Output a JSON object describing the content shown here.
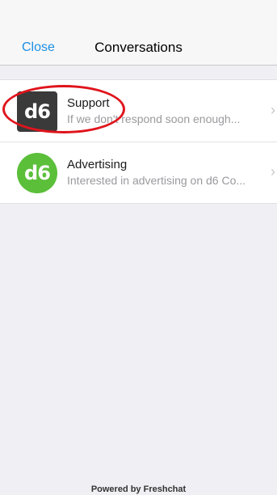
{
  "nav": {
    "close_label": "Close",
    "title": "Conversations"
  },
  "conversations": [
    {
      "avatar_text": "d6",
      "avatar_color": "#3a3a3a",
      "title": "Support",
      "preview": "If we don't respond soon enough..."
    },
    {
      "avatar_text": "d6",
      "avatar_color": "#5bbf3a",
      "title": "Advertising",
      "preview": "Interested in advertising on d6 Co..."
    }
  ],
  "chevron_glyph": "›",
  "footer": {
    "text": "Powered by Freshchat"
  },
  "colors": {
    "accent": "#1b8fe3",
    "highlight": "#e0141c"
  }
}
